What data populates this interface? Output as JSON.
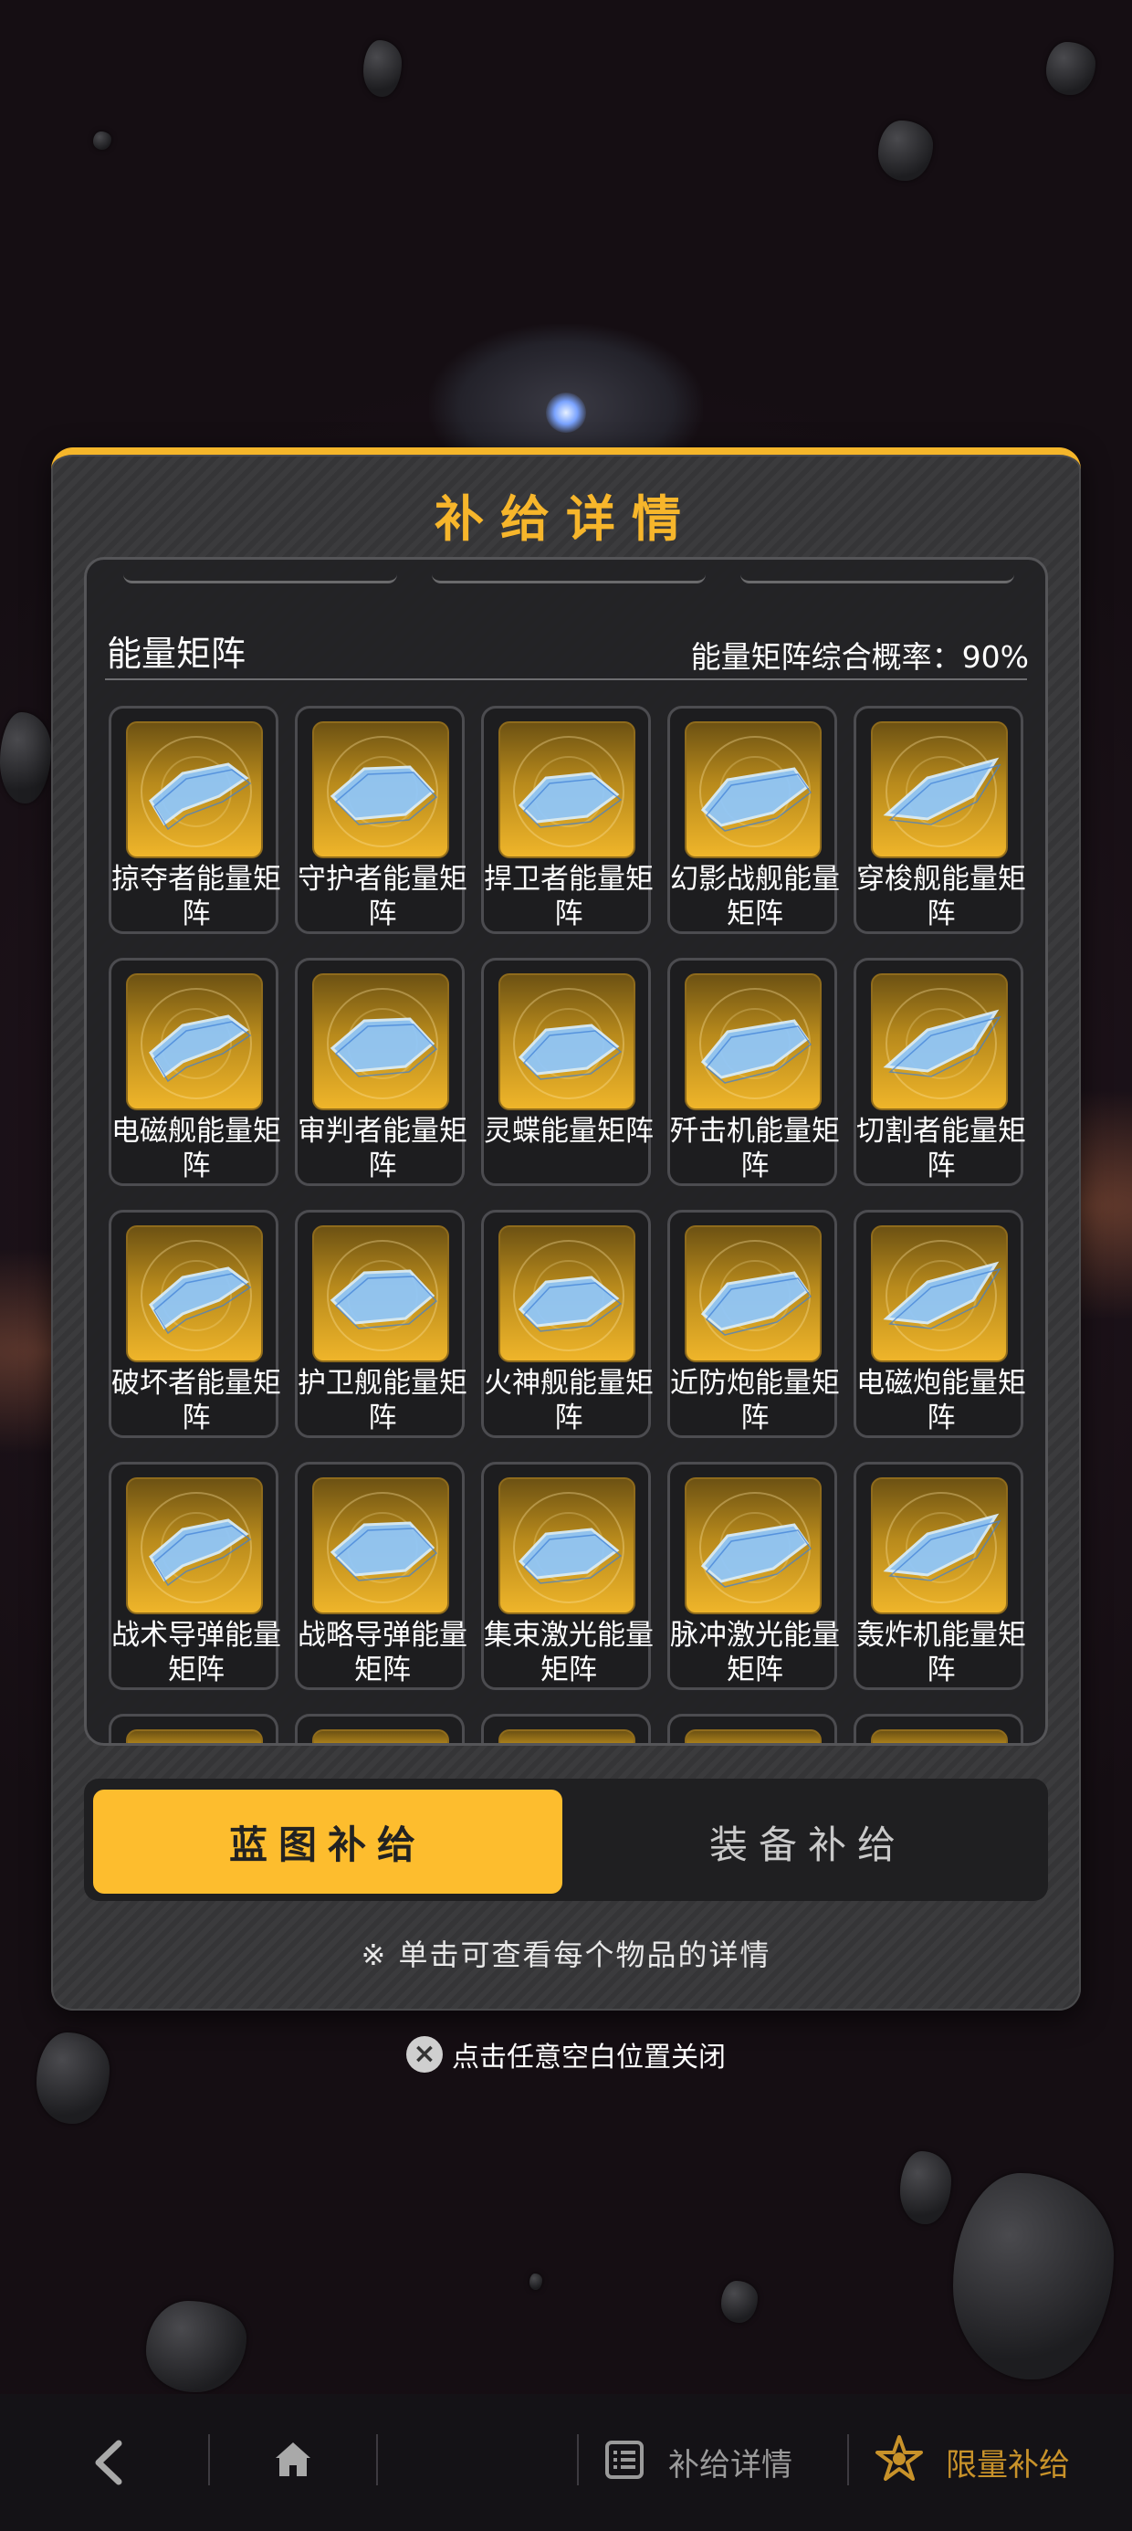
{
  "dialog": {
    "title": "补给详情",
    "section_title": "能量矩阵",
    "section_rate": "能量矩阵综合概率：90%",
    "items": [
      {
        "name": "掠夺者能量矩阵",
        "icon": "ship-marauder-icon"
      },
      {
        "name": "守护者能量矩阵",
        "icon": "ship-guardian-icon"
      },
      {
        "name": "捍卫者能量矩阵",
        "icon": "ship-defender-icon"
      },
      {
        "name": "幻影战舰能量矩阵",
        "icon": "ship-phantom-icon"
      },
      {
        "name": "穿梭舰能量矩阵",
        "icon": "ship-shuttle-icon"
      },
      {
        "name": "电磁舰能量矩阵",
        "icon": "ship-electromagnetic-icon"
      },
      {
        "name": "审判者能量矩阵",
        "icon": "ship-judge-icon"
      },
      {
        "name": "灵蝶能量矩阵",
        "icon": "ship-butterfly-icon"
      },
      {
        "name": "歼击机能量矩阵",
        "icon": "fighter-jet-icon"
      },
      {
        "name": "切割者能量矩阵",
        "icon": "ship-cutter-icon"
      },
      {
        "name": "破坏者能量矩阵",
        "icon": "ship-destroyer-icon"
      },
      {
        "name": "护卫舰能量矩阵",
        "icon": "ship-escort-icon"
      },
      {
        "name": "火神舰能量矩阵",
        "icon": "ship-vulcan-icon"
      },
      {
        "name": "近防炮能量矩阵",
        "icon": "turret-close-defense-icon"
      },
      {
        "name": "电磁炮能量矩阵",
        "icon": "turret-railgun-icon"
      },
      {
        "name": "战术导弹能量矩阵",
        "icon": "turret-tactical-missile-icon"
      },
      {
        "name": "战略导弹能量矩阵",
        "icon": "turret-strategic-missile-icon"
      },
      {
        "name": "集束激光能量矩阵",
        "icon": "turret-beam-laser-icon"
      },
      {
        "name": "脉冲激光能量矩阵",
        "icon": "turret-pulse-laser-icon"
      },
      {
        "name": "轰炸机能量矩阵",
        "icon": "bomber-icon"
      }
    ],
    "tabs": {
      "blueprint": "蓝图补给",
      "equipment": "装备补给"
    },
    "hint": "※ 单击可查看每个物品的详情"
  },
  "close_hint": "点击任意空白位置关闭",
  "bottom_nav": {
    "detail_label": "补给详情",
    "limited_label": "限量补给"
  },
  "colors": {
    "accent": "#f7b62b",
    "active_tab": "#fdbd2e",
    "limited_label": "#c8922a"
  }
}
